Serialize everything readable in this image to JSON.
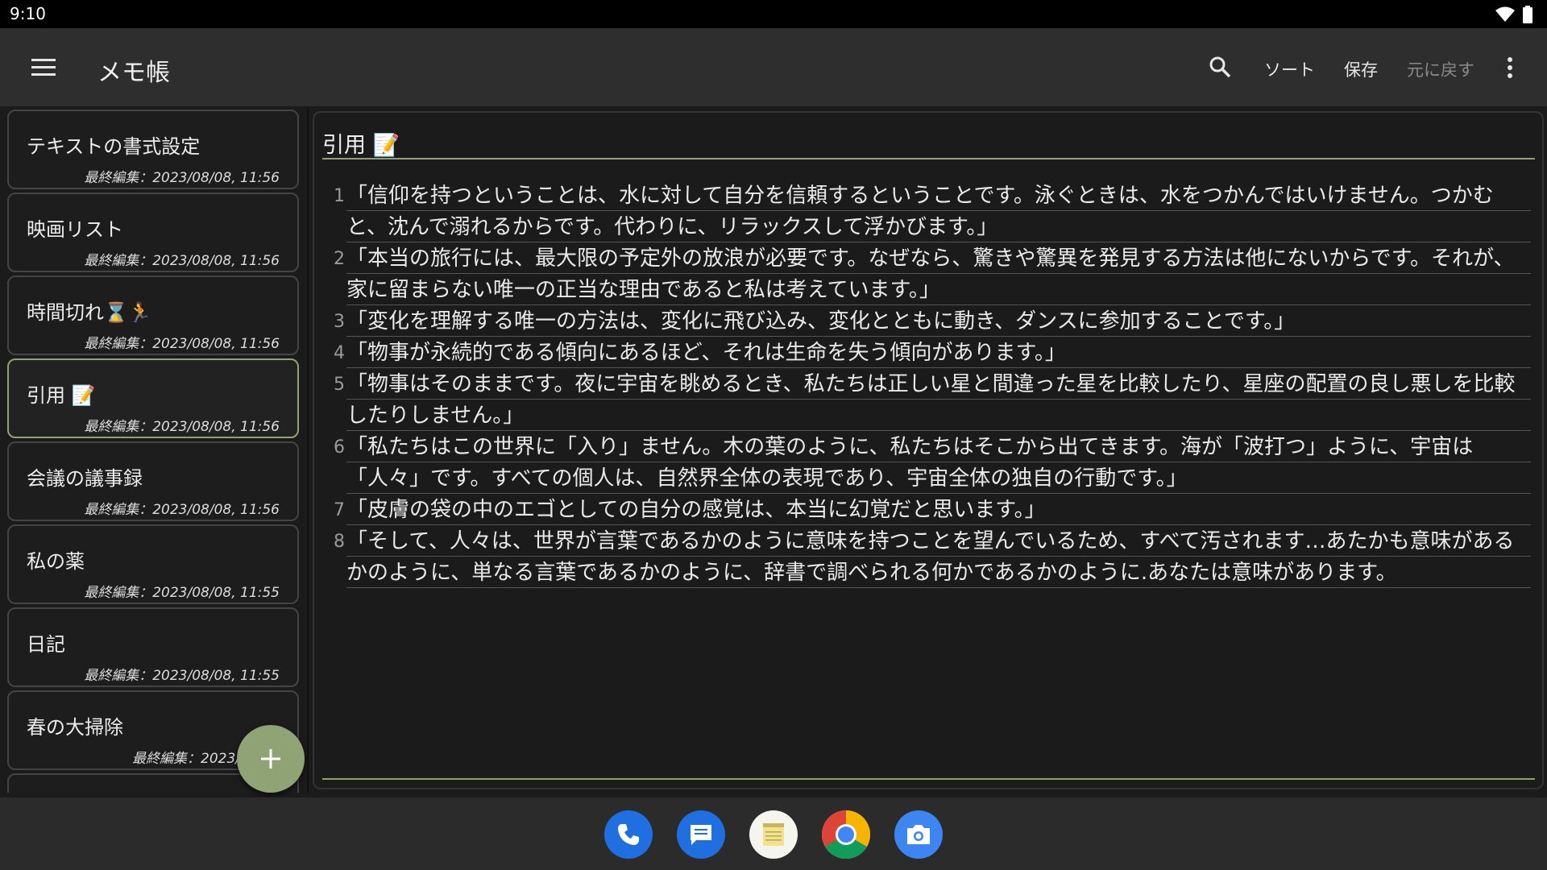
{
  "status": {
    "time": "9:10"
  },
  "app_bar": {
    "title": "メモ帳",
    "actions": {
      "sort": "ソート",
      "save": "保存",
      "undo": "元に戻す"
    }
  },
  "notes": [
    {
      "title": "テキストの書式設定",
      "meta": "最終編集：2023/08/08, 11:56",
      "selected": false
    },
    {
      "title": "映画リスト",
      "meta": "最終編集：2023/08/08, 11:56",
      "selected": false
    },
    {
      "title": "時間切れ⌛🏃",
      "meta": "最終編集：2023/08/08, 11:56",
      "selected": false
    },
    {
      "title": "引用 📝",
      "meta": "最終編集：2023/08/08, 11:56",
      "selected": true
    },
    {
      "title": "会議の議事録",
      "meta": "最終編集：2023/08/08, 11:56",
      "selected": false
    },
    {
      "title": "私の薬",
      "meta": "最終編集：2023/08/08, 11:55",
      "selected": false
    },
    {
      "title": "日記",
      "meta": "最終編集：2023/08/08, 11:55",
      "selected": false
    },
    {
      "title": "春の大掃除",
      "meta": "最終編集：2023/08/08",
      "selected": false
    }
  ],
  "editor": {
    "title": "引用 📝",
    "lines": [
      {
        "num": "1",
        "text": "「信仰を持つということは、水に対して自分を信頼するということです。泳ぐときは、水をつかんではいけません。つかむと、沈んで溺れるからです。代わりに、リラックスして浮かびます。」"
      },
      {
        "num": "2",
        "text": "「本当の旅行には、最大限の予定外の放浪が必要です。なぜなら、驚きや驚異を発見する方法は他にないからです。それが、家に留まらない唯一の正当な理由であると私は考えています。」"
      },
      {
        "num": "3",
        "text": "「変化を理解する唯一の方法は、変化に飛び込み、変化とともに動き、ダンスに参加することです。」"
      },
      {
        "num": "4",
        "text": "「物事が永続的である傾向にあるほど、それは生命を失う傾向があります。」"
      },
      {
        "num": "5",
        "text": "「物事はそのままです。夜に宇宙を眺めるとき、私たちは正しい星と間違った星を比較したり、星座の配置の良し悪しを比較したりしません。」"
      },
      {
        "num": "6",
        "text": "「私たちはこの世界に「入り」ません。木の葉のように、私たちはそこから出てきます。海が「波打つ」ように、宇宙は「人々」です。すべての個人は、自然界全体の表現であり、宇宙全体の独自の行動です。」"
      },
      {
        "num": "7",
        "text": "「皮膚の袋の中のエゴとしての自分の感覚は、本当に幻覚だと思います。」"
      },
      {
        "num": "8",
        "text": "「そして、人々は、世界が言葉であるかのように意味を持つことを望んでいるため、すべて汚されます…あたかも意味があるかのように、単なる言葉であるかのように、辞書で調べられる何かであるかのように.あなたは意味があります。"
      }
    ]
  },
  "dock": [
    "phone-icon",
    "messages-icon",
    "notepad-icon",
    "chrome-icon",
    "camera-icon"
  ],
  "colors": {
    "accent": "#8fa374",
    "app_bar": "#2e2e2e",
    "background": "#1b1b1b"
  }
}
